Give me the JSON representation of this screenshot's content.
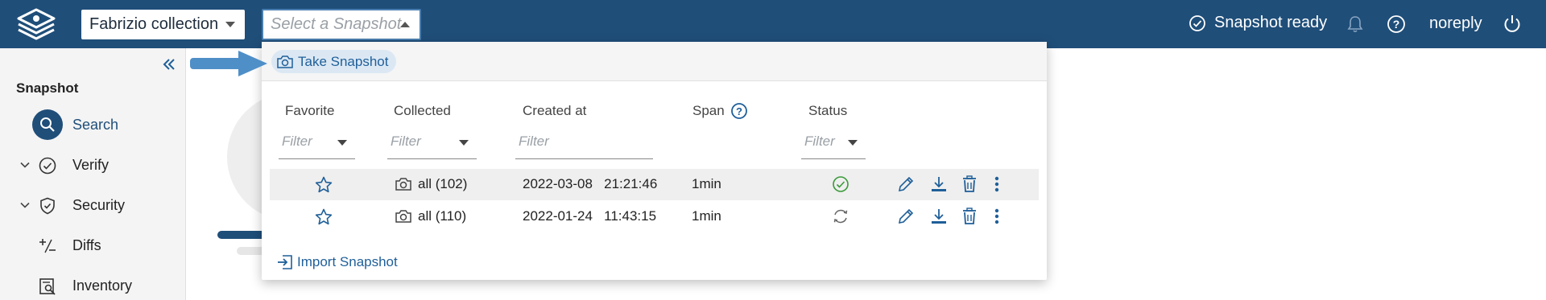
{
  "topbar": {
    "collection_select": "Fabrizio collection",
    "snapshot_select_placeholder": "Select a Snapshot",
    "status": "Snapshot ready",
    "user": "noreply"
  },
  "sidebar": {
    "section_title": "Snapshot",
    "items": [
      {
        "label": "Search",
        "icon": "search-icon",
        "active": true
      },
      {
        "label": "Verify",
        "icon": "check-circle-icon",
        "expandable": true
      },
      {
        "label": "Security",
        "icon": "shield-check-icon",
        "expandable": true
      },
      {
        "label": "Diffs",
        "icon": "diff-icon"
      },
      {
        "label": "Inventory",
        "icon": "inventory-icon"
      }
    ]
  },
  "panel": {
    "take_snapshot": "Take Snapshot",
    "import_snapshot": "Import Snapshot",
    "columns": {
      "favorite": "Favorite",
      "collected": "Collected",
      "created_at": "Created at",
      "span": "Span",
      "status": "Status"
    },
    "filter_placeholder": "Filter",
    "rows": [
      {
        "collected": "all (102)",
        "created_at": "2022-03-08   21:21:46",
        "span": "1min",
        "status": "ready"
      },
      {
        "collected": "all (110)",
        "created_at": "2022-01-24   11:43:15",
        "span": "1min",
        "status": "processing"
      }
    ]
  },
  "colors": {
    "topbar": "#1f4e79",
    "accent": "#1f5f99",
    "ready": "#3a9a3a"
  }
}
